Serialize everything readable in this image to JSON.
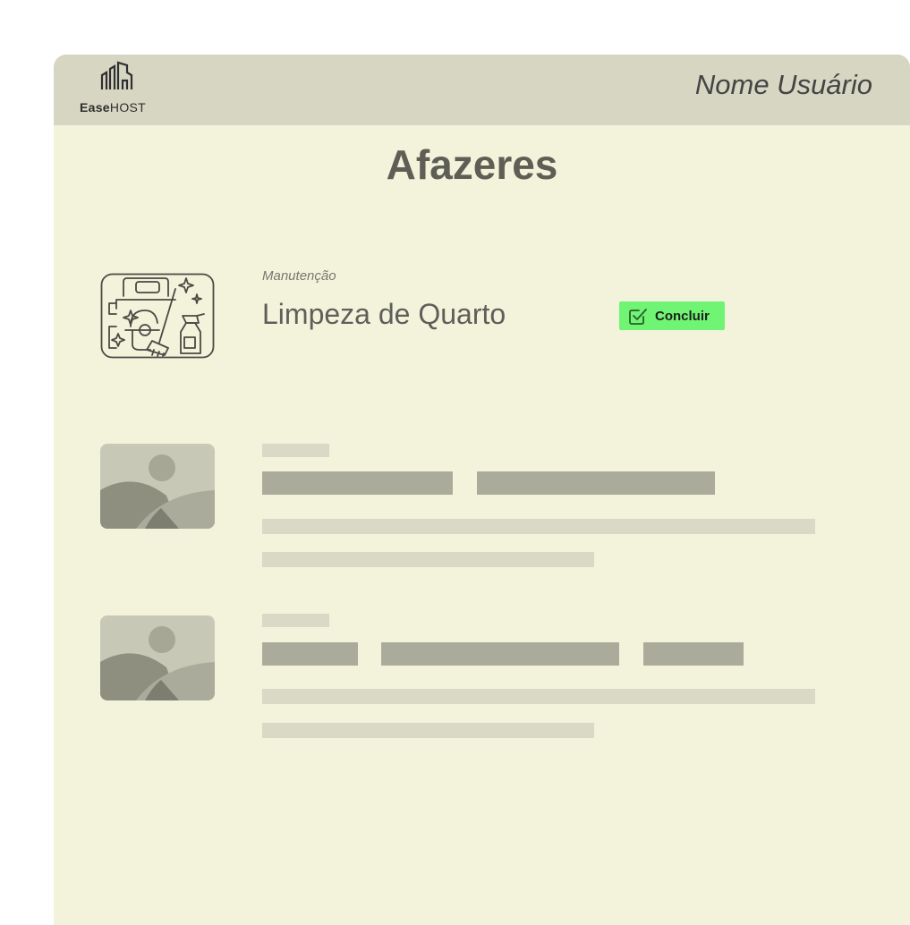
{
  "header": {
    "logo_bold": "Ease",
    "logo_regular": "HOST",
    "user_name": "Nome Usuário"
  },
  "page": {
    "title": "Afazeres"
  },
  "tasks": [
    {
      "category": "Manutenção",
      "title": "Limpeza de Quarto",
      "action_label": "Concluir",
      "icon": "cleaning-icon"
    }
  ],
  "colors": {
    "header_bg": "#d6d6c3",
    "page_bg": "#f3f3dc",
    "action_green": "#6ff573",
    "title_text": "#5e5e55",
    "skeleton_dark": "#abab9b",
    "skeleton_light": "#d9d9c6"
  }
}
